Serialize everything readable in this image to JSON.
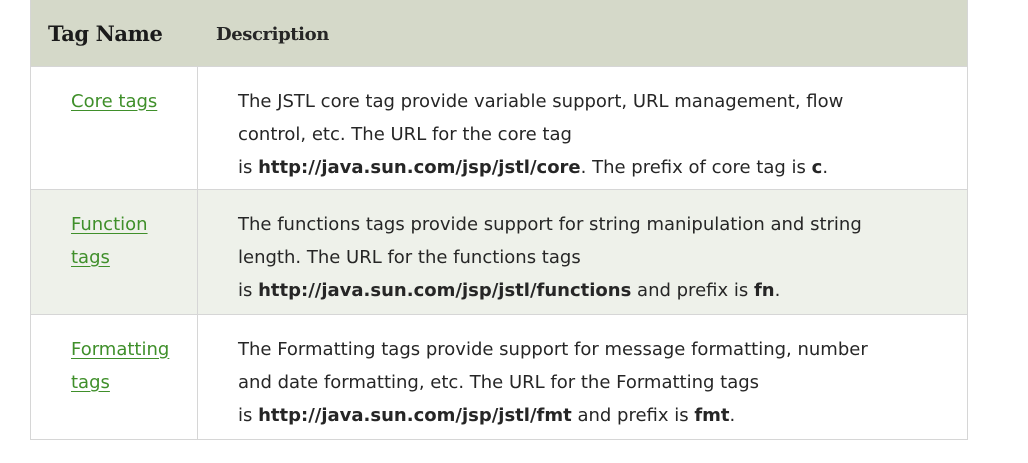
{
  "table": {
    "headers": {
      "name": "Tag Name",
      "description": "Description"
    },
    "rows": [
      {
        "tag": "Core tags",
        "line1": "The JSTL core tag provide variable support, URL management, flow",
        "line2": "control, etc. The URL for the core tag",
        "is_prefix": "is ",
        "url": "http://java.sun.com/jsp/jstl/core",
        "mid": ". The prefix of core tag is ",
        "prefix": "c",
        "end": "."
      },
      {
        "tag": "Function tags",
        "line1": "The functions tags provide support for string manipulation and string",
        "line2": "length. The URL for the functions tags",
        "is_prefix": "is ",
        "url": "http://java.sun.com/jsp/jstl/functions",
        "mid": " and prefix is ",
        "prefix": "fn",
        "end": "."
      },
      {
        "tag": "Formatting tags",
        "line1": "The Formatting tags provide support for message formatting, number",
        "line2": "and date formatting, etc. The URL for the Formatting tags",
        "is_prefix": "is ",
        "url": "http://java.sun.com/jsp/jstl/fmt",
        "mid": " and prefix is ",
        "prefix": "fmt",
        "end": "."
      }
    ]
  },
  "colors": {
    "header_bg": "#d5d9c9",
    "alt_row_bg": "#eef1ea",
    "link": "#3f8f2a",
    "border": "#d6d6d6"
  }
}
